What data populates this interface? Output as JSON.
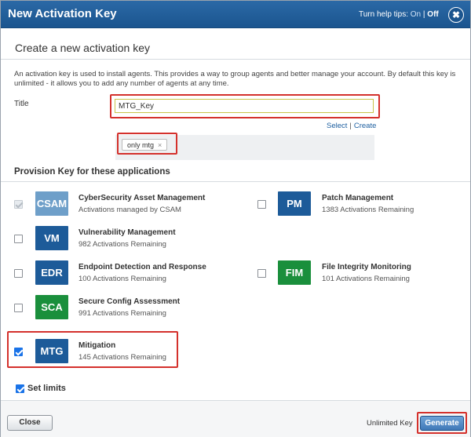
{
  "header": {
    "title": "New Activation Key",
    "help_tips_label": "Turn help tips:",
    "help_on": "On",
    "help_separator": "|",
    "help_off": "Off",
    "close_glyph": "✖"
  },
  "subheader": "Create a new activation key",
  "description": "An activation key is used to install agents. This provides a way to group agents and better manage your account. By default this key is unlimited - it allows you to add any number of agents at any time.",
  "title_field": {
    "label": "Title",
    "value": "MTG_Key"
  },
  "tags": {
    "select_label": "Select",
    "separator": "|",
    "create_label": "Create",
    "items": [
      {
        "label": "only mtg",
        "remove": "×"
      }
    ]
  },
  "provision": {
    "section_title": "Provision Key for these applications",
    "apps": [
      {
        "code": "CSAM",
        "name": "CyberSecurity Asset Management",
        "sub": "Activations managed by CSAM",
        "checked": true,
        "disabled": true,
        "color": "#6e9fc9"
      },
      {
        "code": "PM",
        "name": "Patch Management",
        "sub": "1383 Activations Remaining",
        "checked": false,
        "disabled": false,
        "color": "#1d5b99"
      },
      {
        "code": "VM",
        "name": "Vulnerability Management",
        "sub": "982 Activations Remaining",
        "checked": false,
        "disabled": false,
        "color": "#1d5b99"
      },
      {
        "code": "EDR",
        "name": "Endpoint Detection and Response",
        "sub": "100 Activations Remaining",
        "checked": false,
        "disabled": false,
        "color": "#1d5b99"
      },
      {
        "code": "FIM",
        "name": "File Integrity Monitoring",
        "sub": "101 Activations Remaining",
        "checked": false,
        "disabled": false,
        "color": "#1a8f3c"
      },
      {
        "code": "SCA",
        "name": "Secure Config Assessment",
        "sub": "991 Activations Remaining",
        "checked": false,
        "disabled": false,
        "color": "#1a8f3c"
      },
      {
        "code": "MTG",
        "name": "Mitigation",
        "sub": "145 Activations Remaining",
        "checked": true,
        "disabled": false,
        "color": "#1d5b99"
      }
    ]
  },
  "set_limits": {
    "label": "Set limits",
    "checked": true
  },
  "footer": {
    "close_label": "Close",
    "unlimited_label": "Unlimited Key",
    "generate_label": "Generate"
  },
  "colors": {
    "header": "#1b558f",
    "highlight": "#d4312c",
    "link": "#1d5fa0",
    "checkbox": "#1a73e8"
  }
}
